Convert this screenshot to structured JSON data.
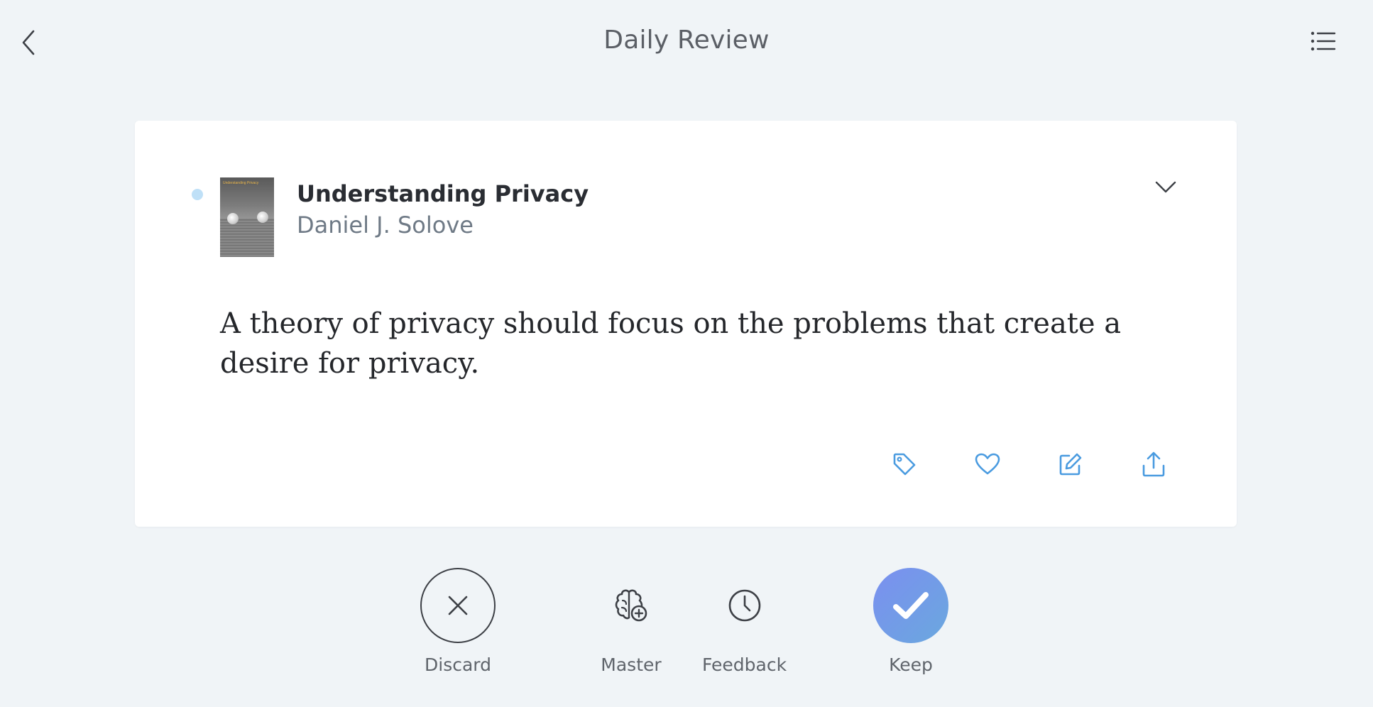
{
  "header": {
    "title": "Daily Review"
  },
  "card": {
    "book_title": "Understanding Privacy",
    "book_author": "Daniel J. Solove",
    "cover_title": "Understanding Privacy",
    "highlight": "A theory of privacy should focus on the problems that create a desire for privacy.",
    "unread_dot_color": "#bfe0f7",
    "action_icons": [
      "tag-icon",
      "heart-icon",
      "edit-icon",
      "share-icon"
    ],
    "action_color": "#4a9be0"
  },
  "bottom_actions": {
    "discard_label": "Discard",
    "master_label": "Master",
    "feedback_label": "Feedback",
    "keep_label": "Keep"
  },
  "colors": {
    "background": "#f0f4f7",
    "keep_gradient_start": "#7b8ff0",
    "keep_gradient_end": "#6aa8de"
  }
}
